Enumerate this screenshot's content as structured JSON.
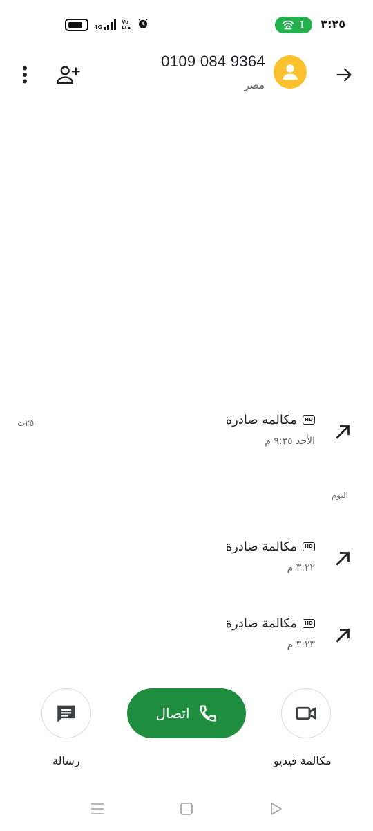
{
  "status_bar": {
    "time": "٣:٢٥",
    "hotspot_count": "1",
    "network": "4G",
    "volte": "Vo LTE"
  },
  "header": {
    "phone_number": "0109 084 9364",
    "country": "مصر"
  },
  "call_history": {
    "side_date": "٢٥ث",
    "section_today": "اليوم",
    "hd_label": "HD",
    "entries": [
      {
        "type": "مكالمة صادرة",
        "time": "الأحد ٩:٣٥ م"
      },
      {
        "type": "مكالمة صادرة",
        "time": "٣:٢٢ م"
      },
      {
        "type": "مكالمة صادرة",
        "time": "٣:٢٣ م"
      }
    ]
  },
  "actions": {
    "call_label": "اتصال",
    "message_label": "رسالة",
    "video_label": "مكالمة فيديو"
  },
  "colors": {
    "accent_green": "#1e8e3e",
    "hotspot_green": "#22b14c",
    "avatar_yellow": "#fbc02d",
    "icon_gray": "#5f6368"
  }
}
